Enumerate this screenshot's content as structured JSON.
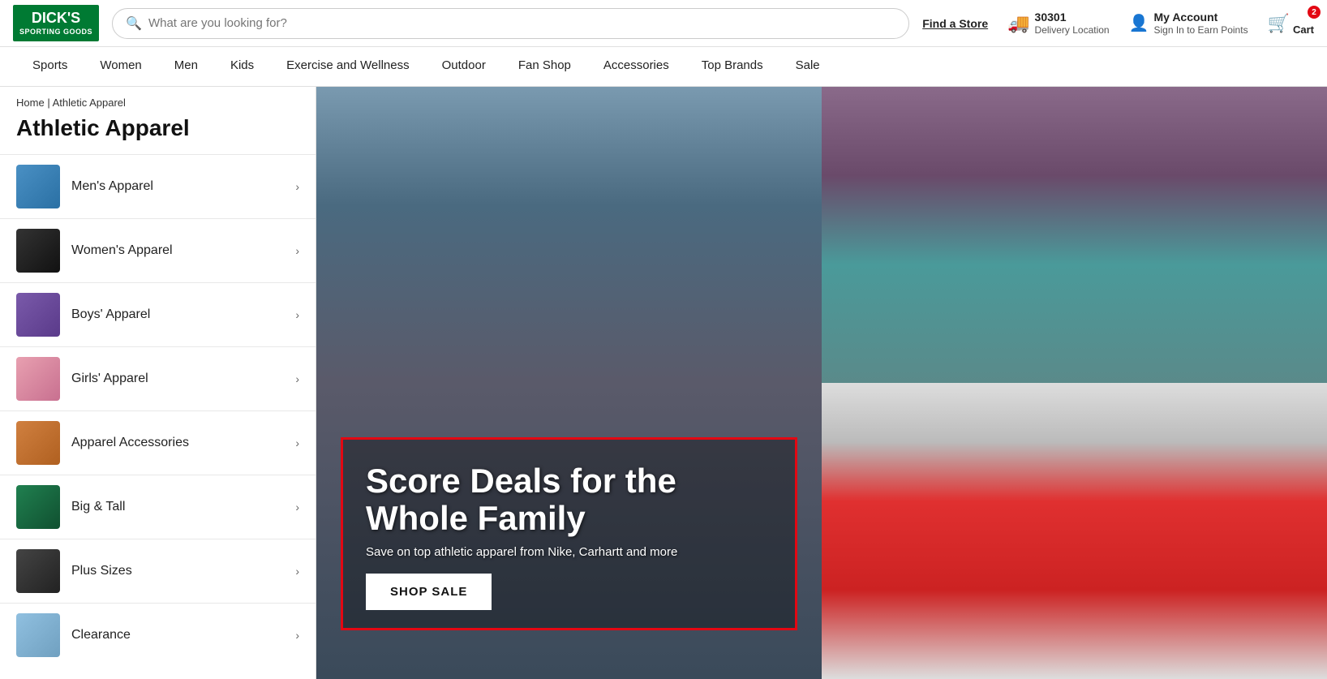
{
  "header": {
    "logo_line1": "DICK'S",
    "logo_line2": "SPORTING GOODS",
    "search_placeholder": "What are you looking for?",
    "find_store_label": "Find a Store",
    "delivery": {
      "zip": "30301",
      "label": "Delivery Location",
      "icon": "🚚"
    },
    "account": {
      "name": "My Account",
      "sub": "Sign In to Earn Points",
      "icon": "👤"
    },
    "cart": {
      "label": "Cart",
      "badge": "2",
      "icon": "🛒"
    }
  },
  "nav": {
    "items": [
      {
        "label": "Sports"
      },
      {
        "label": "Women"
      },
      {
        "label": "Men"
      },
      {
        "label": "Kids"
      },
      {
        "label": "Exercise and Wellness"
      },
      {
        "label": "Outdoor"
      },
      {
        "label": "Fan Shop"
      },
      {
        "label": "Accessories"
      },
      {
        "label": "Top Brands"
      },
      {
        "label": "Sale"
      }
    ]
  },
  "breadcrumb": {
    "home": "Home",
    "separator": " | ",
    "current": "Athletic Apparel"
  },
  "page_title": "Athletic Apparel",
  "sidebar": {
    "items": [
      {
        "label": "Men's Apparel",
        "thumb_class": "thumb-blue"
      },
      {
        "label": "Women's Apparel",
        "thumb_class": "thumb-black"
      },
      {
        "label": "Boys' Apparel",
        "thumb_class": "thumb-purple"
      },
      {
        "label": "Girls' Apparel",
        "thumb_class": "thumb-pink"
      },
      {
        "label": "Apparel Accessories",
        "thumb_class": "thumb-orange"
      },
      {
        "label": "Big & Tall",
        "thumb_class": "thumb-green"
      },
      {
        "label": "Plus Sizes",
        "thumb_class": "thumb-darkgrey"
      },
      {
        "label": "Clearance",
        "thumb_class": "thumb-lightblue"
      }
    ]
  },
  "promo": {
    "title": "Score Deals for the Whole Family",
    "subtitle": "Save on top athletic apparel from Nike, Carhartt and more",
    "cta": "SHOP SALE"
  }
}
